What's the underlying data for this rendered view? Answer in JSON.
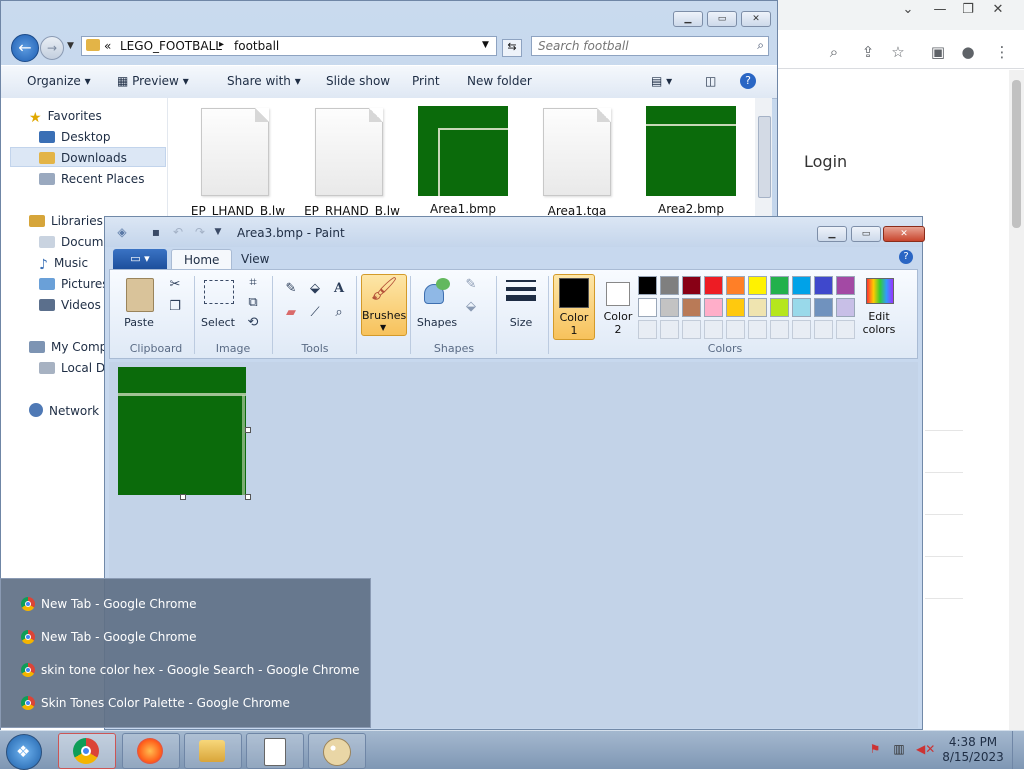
{
  "chrome": {
    "login_label": "Login",
    "window_controls": [
      "chevron-down",
      "minimize",
      "restore",
      "close"
    ],
    "toolbar_icons": [
      "search-icon",
      "share-icon",
      "star-icon",
      "sidebar-icon",
      "profile-icon",
      "menu-icon"
    ]
  },
  "explorer": {
    "breadcrumb": {
      "prefix": "«",
      "segments": [
        "LEGO_FOOTBALL",
        "football"
      ]
    },
    "search_placeholder": "Search football",
    "commands": [
      "Organize",
      "Preview",
      "Share with",
      "Slide show",
      "Print",
      "New folder"
    ],
    "nav": {
      "favorites_header": "Favorites",
      "favorites": [
        "Desktop",
        "Downloads",
        "Recent Places"
      ],
      "libraries_header": "Libraries",
      "libraries": [
        "Docume",
        "Music",
        "Pictures",
        "Videos"
      ],
      "computer_header": "My Compu",
      "computer": [
        "Local Dis"
      ],
      "network": "Network"
    },
    "files": [
      {
        "name": "_EP_LHAND_B.lw",
        "kind": "document"
      },
      {
        "name": "_EP_RHAND_B.lw",
        "kind": "document"
      },
      {
        "name": "Area1.bmp",
        "kind": "image-corner"
      },
      {
        "name": "Area1.tga",
        "kind": "document"
      },
      {
        "name": "Area2.bmp",
        "kind": "image-line"
      }
    ]
  },
  "paint": {
    "title": "Area3.bmp - Paint",
    "tabs": {
      "file": "▾",
      "home": "Home",
      "view": "View"
    },
    "groups": {
      "clipboard": {
        "label": "Clipboard",
        "paste": "Paste"
      },
      "image": {
        "label": "Image",
        "select": "Select"
      },
      "tools": {
        "label": "Tools"
      },
      "brushes": {
        "label": "Brushes"
      },
      "shapes": {
        "label": "Shapes",
        "button": "Shapes"
      },
      "size": {
        "label": "Size"
      },
      "color1": {
        "line1": "Color",
        "line2": "1"
      },
      "color2": {
        "line1": "Color",
        "line2": "2"
      },
      "colors": {
        "label": "Colors"
      },
      "edit_colors": {
        "line1": "Edit",
        "line2": "colors"
      }
    },
    "palette_row1": [
      "#000000",
      "#7f7f7f",
      "#880015",
      "#ed1c24",
      "#ff7f27",
      "#fff200",
      "#22b14c",
      "#00a2e8",
      "#3f48cc",
      "#a349a4"
    ],
    "palette_row2": [
      "#ffffff",
      "#c3c3c3",
      "#b97a57",
      "#ffaec9",
      "#ffc90e",
      "#efe4b0",
      "#b5e61d",
      "#99d9ea",
      "#7092be",
      "#c8bfe7"
    ],
    "color1_value": "#000000",
    "color2_value": "#ffffff",
    "canvas_color": "#0b6b0b"
  },
  "jumplist": {
    "items": [
      "New Tab - Google Chrome",
      "New Tab - Google Chrome",
      "skin tone color hex - Google Search - Google Chrome",
      "Skin Tones Color Palette - Google Chrome"
    ]
  },
  "taskbar": {
    "apps": [
      "chrome",
      "firefox",
      "explorer",
      "notepad",
      "paint"
    ],
    "time": "4:38 PM",
    "date": "8/15/2023"
  }
}
